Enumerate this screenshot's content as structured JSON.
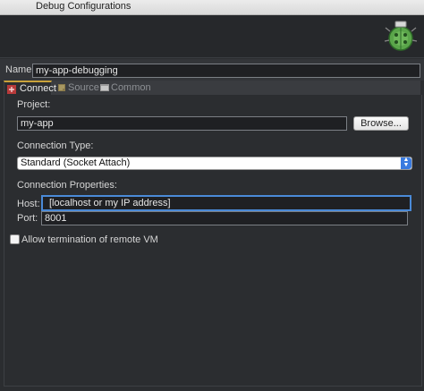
{
  "window": {
    "title": "Debug Configurations"
  },
  "banner": {
    "icon": "bug-icon"
  },
  "config": {
    "name_label": "Name:",
    "name_value": "my-app-debugging"
  },
  "tabs": [
    {
      "label": "Connect",
      "icon": "connect-icon"
    },
    {
      "label": "Source",
      "icon": "source-icon"
    },
    {
      "label": "Common",
      "icon": "common-icon"
    }
  ],
  "project": {
    "label": "Project:",
    "value": "my-app",
    "browse_label": "Browse..."
  },
  "connection_type": {
    "label": "Connection Type:",
    "selected": "Standard (Socket Attach)"
  },
  "connection_properties": {
    "label": "Connection Properties:",
    "host_label": "Host:",
    "host_value": "[localhost or my IP address]",
    "port_label": "Port:",
    "port_value": "8001"
  },
  "allow_termination": {
    "label": "Allow termination of remote VM",
    "checked": false
  },
  "colors": {
    "background": "#2b2d30",
    "accent": "#4a8ad8",
    "tab_active_underline": "#c9a23a"
  }
}
